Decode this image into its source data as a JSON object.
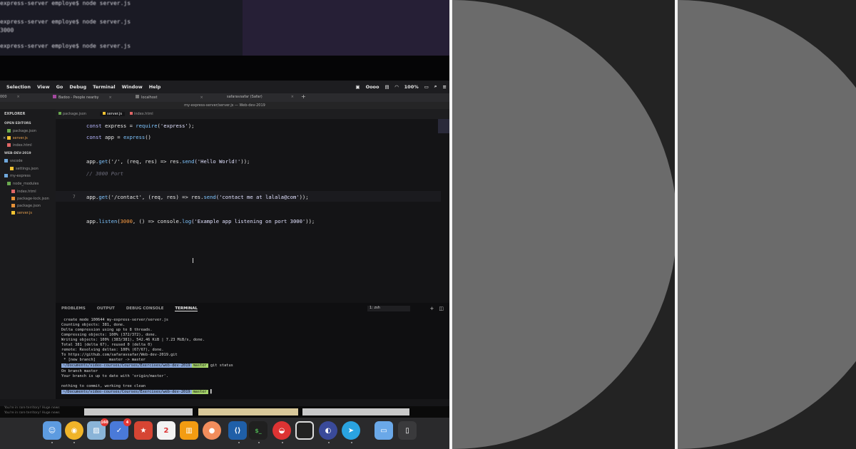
{
  "background_terminal": {
    "lines": [
      "express-server employe$ node server.js",
      "3000",
      "",
      "express-server employe$ node server.js"
    ]
  },
  "menubar": {
    "items": [
      "Selection",
      "View",
      "Go",
      "Debug",
      "Terminal",
      "Window",
      "Help"
    ],
    "right_text": "Oooo",
    "battery": "100%"
  },
  "browser_tabs": [
    {
      "label": "Badoo - People nearby"
    },
    {
      "label": "localhost"
    },
    {
      "label": "safaravsafar (Safar)"
    }
  ],
  "window_title": "my-express-server/server.js — Web-dev-2019",
  "sidebar": {
    "explorer_label": "EXPLORER",
    "open_editors_label": "OPEN EDITORS",
    "open_editors": [
      "package.json",
      "server.js",
      "index.html"
    ],
    "project_label": "WEB-DEV-2019",
    "tree": [
      "vscode",
      "settings.json",
      "my-express",
      "node_modules",
      "index.html",
      "package-lock.json",
      "package.json",
      "server.js"
    ]
  },
  "editor_tabs": [
    "package.json",
    "server.js",
    "index.html"
  ],
  "code": {
    "line1": {
      "kw": "const",
      "name": " express = ",
      "fn": "require",
      "open": "(",
      "str": "'express'",
      "close": ");"
    },
    "line2": {
      "kw": "const",
      "name": " app = ",
      "fn": "express",
      "close": "()"
    },
    "line3": {
      "obj": "app.",
      "fn": "get",
      "a": "('/', (req, res) => res.",
      "fn2": "send",
      "str": "('Hello World!'",
      "close": "));"
    },
    "line4": {
      "comment": "// 3000 Port"
    },
    "line5": {
      "obj": "app.",
      "fn": "get",
      "a": "('/contact', (req, res) => res.",
      "fn2": "send",
      "str": "('contact me at lalala@com'",
      "close": "));"
    },
    "line6": {
      "obj": "app.",
      "fn": "listen",
      "open": "(",
      "num": "3000",
      "mid": ", () => console.",
      "fn2": "log",
      "str": "('Example app listening on port 3000'",
      "close": "));"
    },
    "current_line_number": "7"
  },
  "panel": {
    "tabs": [
      "PROBLEMS",
      "OUTPUT",
      "DEBUG CONSOLE",
      "TERMINAL"
    ],
    "active_tab": "TERMINAL",
    "shell_select": "1: zsh",
    "lines": [
      " create mode 100644 my-express-server/server.js",
      "Counting objects: 381, done.",
      "Delta compression using up to 8 threads.",
      "Compressing objects: 100% (372/372), done.",
      "Writing objects: 100% (383/381), 542.46 KiB | 7.23 MiB/s, done.",
      "Total 381 (delta 67), reused 0 (delta 0)",
      "remote: Resolving deltas: 100% (67/67), done.",
      "To https://github.com/safaravsafar/Web-dev-2019.git",
      " * [new branch]      master -> master"
    ],
    "prompt_path": "~/Documents/video-courses/Courses/Exercises/web-dev-2019",
    "prompt_branch": "master",
    "cmd": "git status",
    "status_lines": [
      "On branch master",
      "Your branch is up to date with 'origin/master'.",
      "",
      "nothing to commit, working tree clean"
    ]
  },
  "notifications": [
    "You're in rare territory! Huge news",
    "You're in rare territory! Huge news"
  ],
  "dock": {
    "badges": {
      "mail": "160",
      "tasks": "4"
    },
    "calendar_day": "2"
  }
}
